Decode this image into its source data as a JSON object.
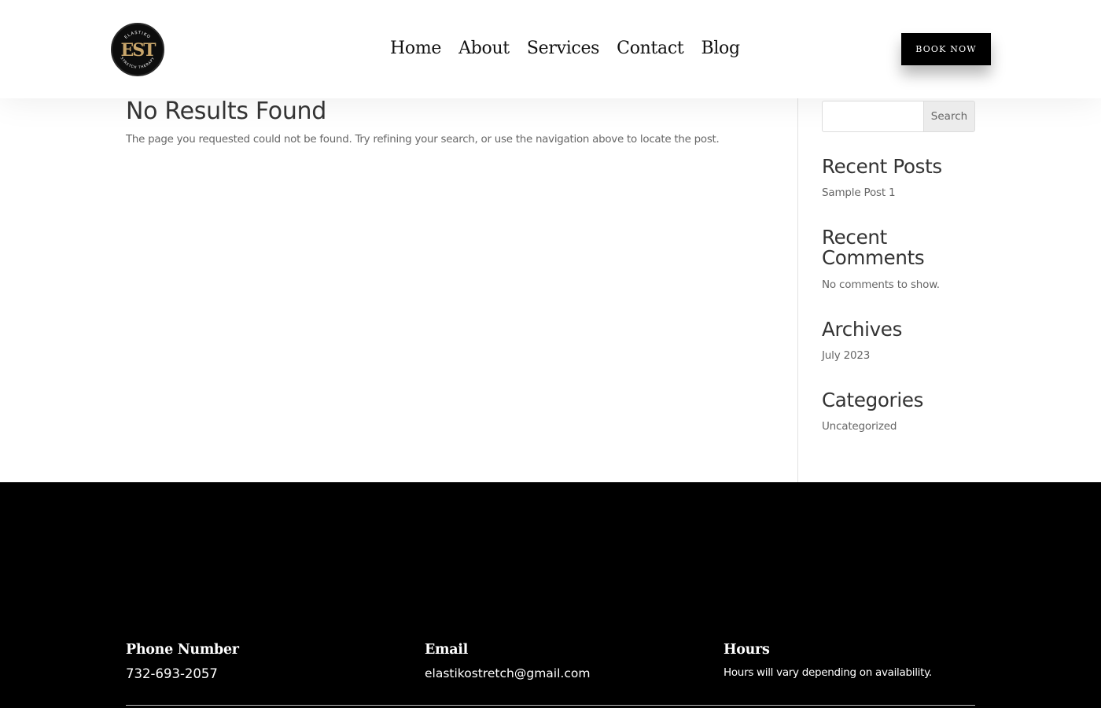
{
  "header": {
    "logo": {
      "top_text": "ELASTIKO",
      "monogram": "EST",
      "bottom_text": "STRETCH THERAPY",
      "colors": {
        "background": "#0d0d0d",
        "gold": "#c9a66b"
      }
    },
    "nav": [
      {
        "label": "Home"
      },
      {
        "label": "About"
      },
      {
        "label": "Services"
      },
      {
        "label": "Contact"
      },
      {
        "label": "Blog"
      }
    ],
    "book_button": "BOOK NOW"
  },
  "main": {
    "title": "No Results Found",
    "message": "The page you requested could not be found. Try refining your search, or use the navigation above to locate the post."
  },
  "sidebar": {
    "search": {
      "placeholder": "",
      "button": "Search"
    },
    "widgets": [
      {
        "title": "Recent Posts",
        "items": [
          "Sample Post 1"
        ]
      },
      {
        "title": "Recent Comments",
        "items": [
          "No comments to show."
        ]
      },
      {
        "title": "Archives",
        "items": [
          "July 2023"
        ]
      },
      {
        "title": "Categories",
        "items": [
          "Uncategorized"
        ]
      }
    ]
  },
  "footer": {
    "columns": [
      {
        "heading": "Phone Number",
        "value": "732-693-2057"
      },
      {
        "heading": "Email",
        "value": "elastikostretch@gmail.com"
      },
      {
        "heading": "Hours",
        "value": "Hours will vary depending on availability."
      }
    ]
  }
}
